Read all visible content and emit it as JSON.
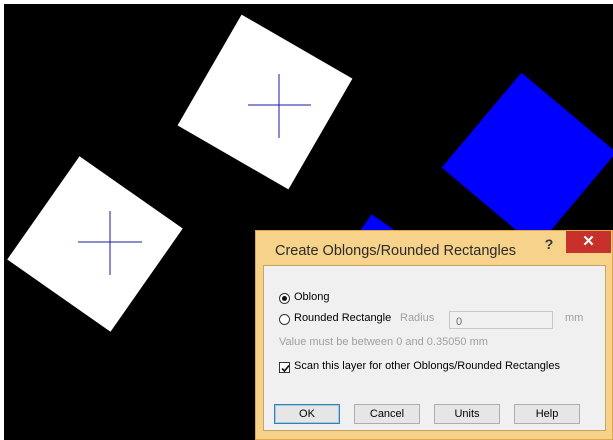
{
  "dialog": {
    "title": "Create Oblongs/Rounded Rectangles",
    "help_label": "?",
    "close_label": "✕",
    "oblong_label": "Oblong",
    "rounded_label": "Rounded Rectangle",
    "radius_label": "Radius",
    "radius_value": "0",
    "unit_label": "mm",
    "hint": "Value must be between 0 and 0.35050 mm",
    "scan_label": "Scan this layer for other Oblongs/Rounded Rectangles",
    "selected_shape": "Oblong",
    "scan_checked": true,
    "buttons": {
      "ok": "OK",
      "cancel": "Cancel",
      "units": "Units",
      "help": "Help"
    }
  },
  "colors": {
    "canvas_background": "#000000",
    "pad": "#ffffff",
    "shape_blue": "#0000ff",
    "crosshair": "#1a1aa6",
    "dialog_frame": "#f6d28a",
    "close_button": "#c7302b"
  }
}
